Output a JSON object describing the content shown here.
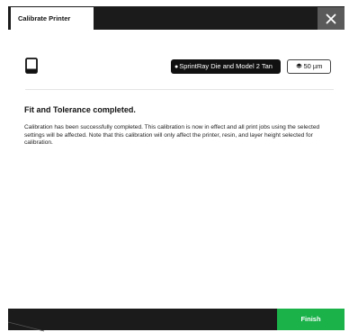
{
  "window": {
    "tab_title": "Calibrate Printer",
    "close_icon": "close-icon"
  },
  "toolbar": {
    "printer_icon": "printer-icon",
    "resin_icon": "resin-drop-icon",
    "resin_label": "SprintRay Die and Model 2 Tan",
    "layer_icon": "layer-stack-icon",
    "layer_height": "50 µm"
  },
  "main": {
    "heading": "Fit and Tolerance completed.",
    "body": "Calibration has been successfully completed. This calibration is now in effect and all print jobs using the selected settings will be affected. Note that this calibration will only affect the printer, resin, and layer height selected for calibration."
  },
  "footer": {
    "finish_label": "Finish"
  },
  "colors": {
    "titlebar_bg": "#1b1b1b",
    "close_bg": "#5a5a5a",
    "finish_bg": "#1bb24a",
    "chip_bg": "#111111"
  }
}
